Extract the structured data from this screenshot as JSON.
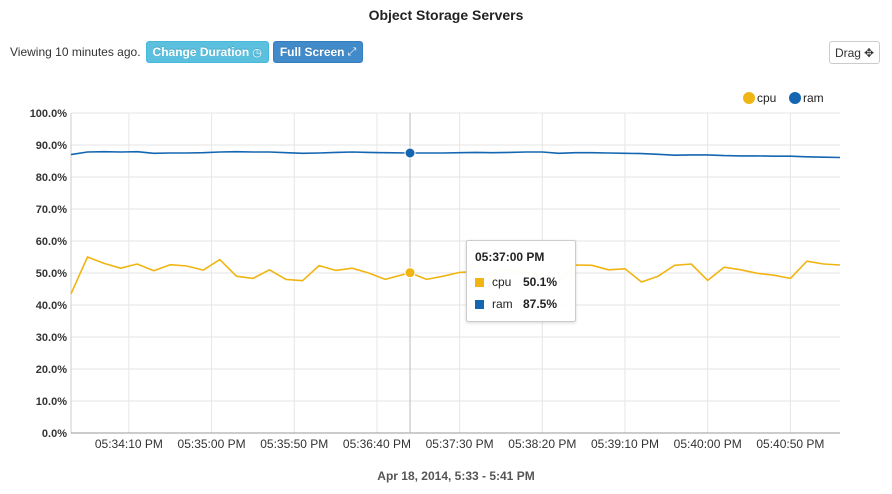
{
  "title": "Object Storage Servers",
  "toolbar": {
    "viewing": "Viewing 10 minutes ago.",
    "change_duration": "Change Duration",
    "change_duration_icon": "clock-icon",
    "full_screen": "Full Screen",
    "full_screen_icon": "expand-icon",
    "drag": "Drag",
    "drag_icon": "move-arrows-icon"
  },
  "footer": "Apr 18, 2014, 5:33 - 5:41 PM",
  "tooltip": {
    "time": "05:37:00 PM",
    "rows": [
      {
        "name": "cpu",
        "value": "50.1%",
        "color": "#f0b513"
      },
      {
        "name": "ram",
        "value": "87.5%",
        "color": "#1466b0"
      }
    ]
  },
  "chart_data": {
    "type": "line",
    "title": "Object Storage Servers",
    "xlabel": "Apr 18, 2014, 5:33 - 5:41 PM",
    "ylabel": "",
    "ylim": [
      0,
      100
    ],
    "yticks": [
      "0.0%",
      "10.0%",
      "20.0%",
      "30.0%",
      "40.0%",
      "50.0%",
      "60.0%",
      "70.0%",
      "80.0%",
      "90.0%",
      "100.0%"
    ],
    "xlim": [
      "05:33:35 PM",
      "05:41:20 PM"
    ],
    "xticks": [
      "05:34:10 PM",
      "05:35:00 PM",
      "05:35:50 PM",
      "05:36:40 PM",
      "05:37:30 PM",
      "05:38:20 PM",
      "05:39:10 PM",
      "05:40:00 PM",
      "05:40:50 PM"
    ],
    "grid": true,
    "legend": "top-right",
    "highlight_x": "05:37:00 PM",
    "x": [
      "05:33:35 PM",
      "05:33:45 PM",
      "05:33:55 PM",
      "05:34:05 PM",
      "05:34:15 PM",
      "05:34:25 PM",
      "05:34:35 PM",
      "05:34:45 PM",
      "05:34:55 PM",
      "05:35:05 PM",
      "05:35:15 PM",
      "05:35:25 PM",
      "05:35:35 PM",
      "05:35:45 PM",
      "05:35:55 PM",
      "05:36:05 PM",
      "05:36:15 PM",
      "05:36:25 PM",
      "05:36:35 PM",
      "05:36:45 PM",
      "05:37:00 PM",
      "05:37:10 PM",
      "05:37:20 PM",
      "05:37:30 PM",
      "05:37:40 PM",
      "05:37:50 PM",
      "05:38:00 PM",
      "05:38:10 PM",
      "05:38:20 PM",
      "05:38:30 PM",
      "05:38:40 PM",
      "05:38:50 PM",
      "05:39:00 PM",
      "05:39:10 PM",
      "05:39:20 PM",
      "05:39:30 PM",
      "05:39:40 PM",
      "05:39:50 PM",
      "05:40:00 PM",
      "05:40:10 PM",
      "05:40:20 PM",
      "05:40:30 PM",
      "05:40:40 PM",
      "05:40:50 PM",
      "05:41:00 PM",
      "05:41:10 PM",
      "05:41:20 PM"
    ],
    "series": [
      {
        "name": "cpu",
        "color": "#f0b513",
        "values": [
          43.5,
          55.0,
          53.0,
          51.5,
          52.8,
          50.7,
          52.6,
          52.2,
          50.9,
          54.2,
          49.0,
          48.3,
          51.0,
          48.0,
          47.6,
          52.3,
          50.8,
          51.5,
          50.0,
          48.0,
          50.1,
          48.0,
          49.0,
          50.2,
          50.5,
          49.8,
          51.0,
          50.0,
          49.5,
          47.0,
          52.5,
          52.4,
          51.0,
          51.3,
          47.2,
          49.0,
          52.4,
          52.8,
          47.7,
          51.8,
          51.0,
          49.9,
          49.3,
          48.3,
          53.7,
          52.8,
          52.5
        ]
      },
      {
        "name": "ram",
        "color": "#1466b0",
        "values": [
          87.0,
          87.8,
          87.9,
          87.8,
          87.9,
          87.4,
          87.5,
          87.5,
          87.6,
          87.8,
          87.9,
          87.8,
          87.8,
          87.6,
          87.4,
          87.5,
          87.7,
          87.8,
          87.7,
          87.6,
          87.5,
          87.5,
          87.5,
          87.6,
          87.7,
          87.6,
          87.7,
          87.8,
          87.8,
          87.4,
          87.6,
          87.6,
          87.5,
          87.4,
          87.3,
          87.1,
          86.8,
          86.9,
          86.9,
          86.7,
          86.6,
          86.6,
          86.5,
          86.5,
          86.3,
          86.2,
          86.1
        ]
      }
    ]
  }
}
